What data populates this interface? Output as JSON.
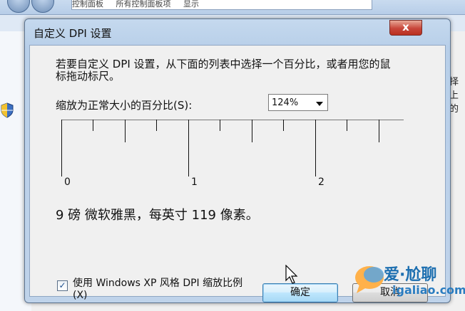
{
  "background": {
    "breadcrumb": [
      "控制面板",
      "所有控制面板项",
      "显示"
    ],
    "right_partial_text": "择上的"
  },
  "dialog": {
    "title": "自定义 DPI 设置",
    "close_glyph": "x",
    "description": "若要自定义 DPI 设置，从下面的列表中选择一个百分比，或者用您的鼠标拖动标尺。",
    "scale_label": "缩放为正常大小的百分比(S):",
    "scale_select": {
      "value": "124%",
      "options": [
        "124%"
      ]
    },
    "ruler_numbers": [
      "0",
      "1",
      "2"
    ],
    "font_info": "9 磅 微软雅黑，每英寸 119 像素。",
    "xp_checkbox": {
      "checked": true,
      "label": "使用 Windows XP 风格 DPI 缩放比例(X)"
    },
    "ok_label": "确定",
    "cancel_label": "取消"
  },
  "watermark": {
    "name": "爱·尬聊",
    "url": "igaliao.com"
  },
  "colors": {
    "title_bar": "#b8cfe9",
    "dialog_body": "#f0f0f0",
    "close_button": "#c8463a",
    "ok_button": "#bee6fd",
    "watermark": "#1d6fb0"
  }
}
